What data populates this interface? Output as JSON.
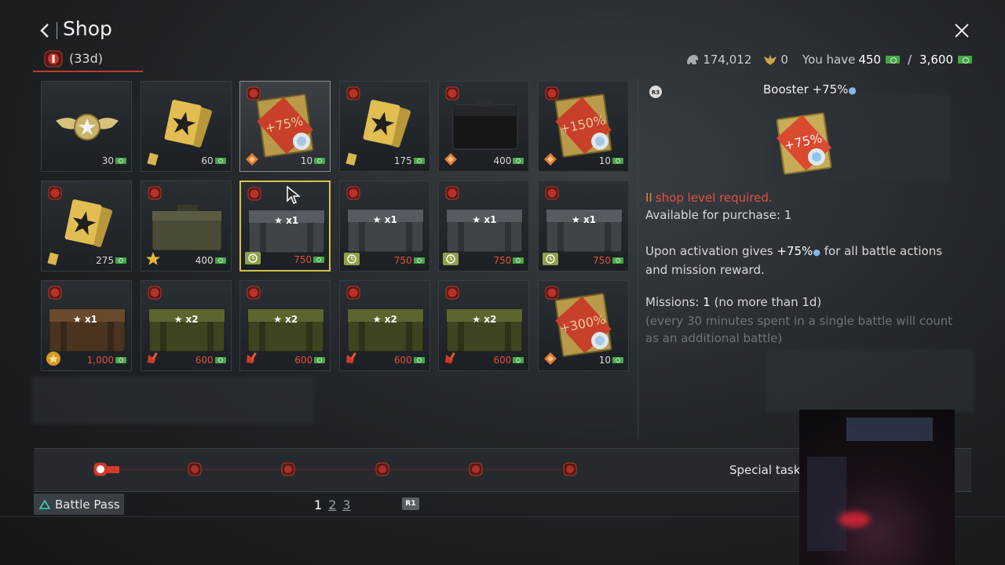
{
  "header": {
    "title": "Shop",
    "level_text": "(33d)",
    "currencies": {
      "silver": "174,012",
      "golden_eagles": "0",
      "you_have_label": "You have",
      "you_have_value": "450",
      "separator": "/",
      "total_value": "3,600"
    }
  },
  "grid": {
    "items": [
      {
        "price": "30",
        "rank": "",
        "type": "wings-emblem"
      },
      {
        "price": "60",
        "rank": "",
        "type": "gold-star-cards"
      },
      {
        "price": "10",
        "rank": "II",
        "type": "booster",
        "booster_label": "+75%"
      },
      {
        "price": "175",
        "rank": "II",
        "type": "gold-star-cards"
      },
      {
        "price": "400",
        "rank": "II",
        "type": "black-crate"
      },
      {
        "price": "10",
        "rank": "II",
        "type": "booster",
        "booster_label": "+150%"
      },
      {
        "price": "275",
        "rank": "III",
        "type": "gold-star-cards"
      },
      {
        "price": "400",
        "rank": "III",
        "type": "olive-toolbox"
      },
      {
        "price": "750",
        "rank": "III",
        "type": "grey-crate",
        "qty": "x1"
      },
      {
        "price": "750",
        "rank": "III",
        "type": "grey-crate",
        "qty": "x1"
      },
      {
        "price": "750",
        "rank": "III",
        "type": "grey-crate",
        "qty": "x1"
      },
      {
        "price": "750",
        "rank": "III",
        "type": "grey-crate",
        "qty": "x1"
      },
      {
        "price": "1,000",
        "rank": "III",
        "type": "brown-crate",
        "qty": "x1"
      },
      {
        "price": "600",
        "rank": "III",
        "type": "green-crate",
        "qty": "x2"
      },
      {
        "price": "600",
        "rank": "III",
        "type": "green-crate",
        "qty": "x2"
      },
      {
        "price": "600",
        "rank": "III",
        "type": "green-crate",
        "qty": "x2"
      },
      {
        "price": "600",
        "rank": "III",
        "type": "green-crate",
        "qty": "x2"
      },
      {
        "price": "10",
        "rank": "IV",
        "type": "booster",
        "booster_label": "+300%"
      }
    ]
  },
  "detail": {
    "r3_badge": "R3",
    "title": "Booster +75%",
    "booster_label": "+75%",
    "req_roman": "II",
    "req_text": "shop level required.",
    "available": "Available for purchase: 1",
    "desc_prefix": "Upon activation gives",
    "desc_value": "+75%",
    "desc_suffix": "for all battle actions and mission reward.",
    "missions_label": "Missions:",
    "missions_value": "1",
    "missions_suffix": "(no more than 1d)",
    "note": "(every 30 minutes spent in a single battle will count as an additional battle)"
  },
  "progress": {
    "stages": [
      "I",
      "II",
      "III",
      "IV",
      "V",
      "VI"
    ],
    "special_task": "Special task"
  },
  "footer": {
    "battle_pass": "Battle Pass",
    "pages": [
      "1",
      "2",
      "3"
    ],
    "r1_badge": "R1"
  },
  "colors": {
    "accent_red": "#e2503a",
    "gold": "#d6c14c",
    "gift_green": "#47a64a"
  }
}
